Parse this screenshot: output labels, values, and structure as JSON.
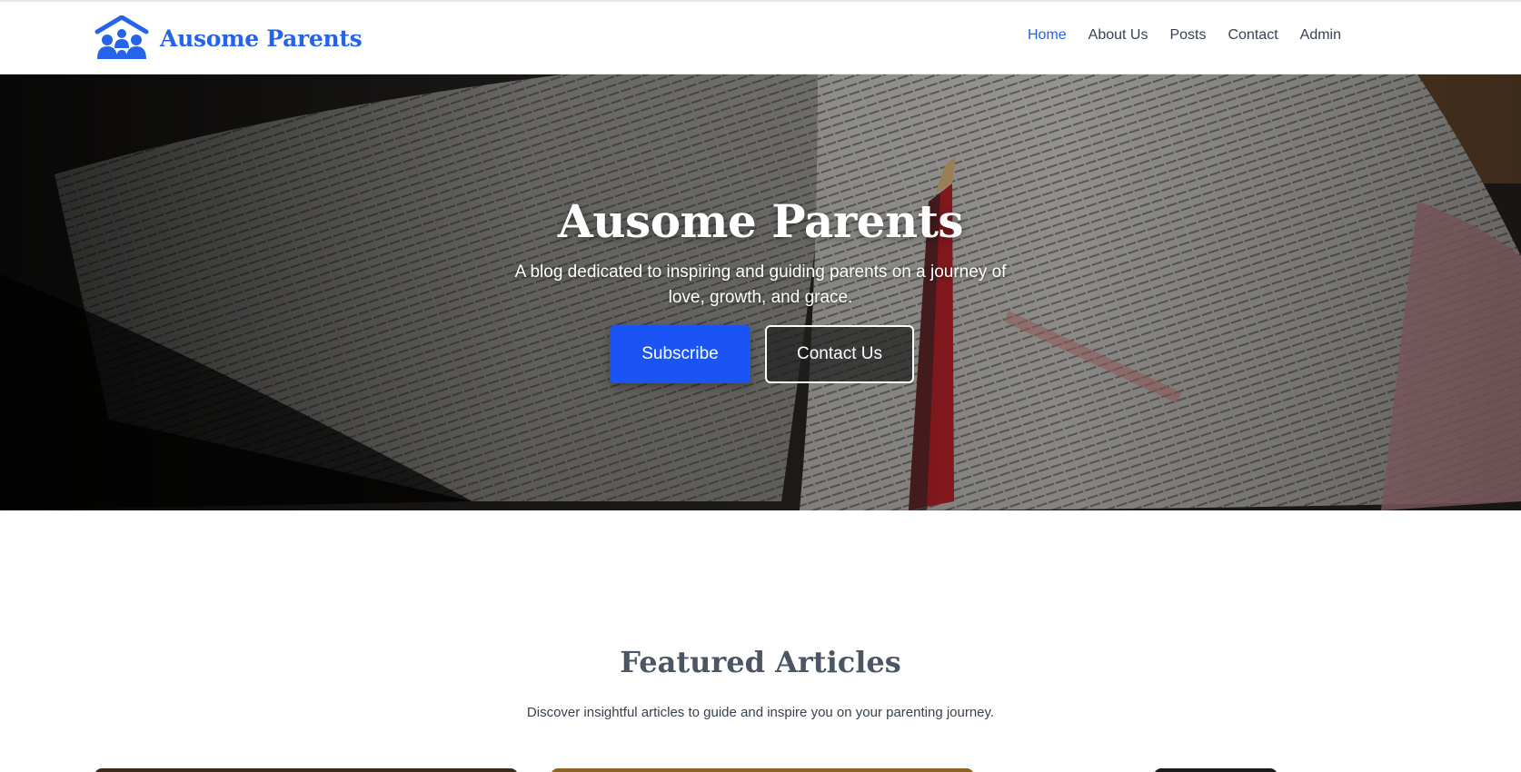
{
  "brand": {
    "name": "Ausome Parents",
    "logo_icon": "family-house-icon",
    "color": "#2563eb"
  },
  "nav": {
    "items": [
      {
        "label": "Home",
        "active": true
      },
      {
        "label": "About Us",
        "active": false
      },
      {
        "label": "Posts",
        "active": false
      },
      {
        "label": "Contact",
        "active": false
      },
      {
        "label": "Admin",
        "active": false
      }
    ]
  },
  "hero": {
    "title": "Ausome Parents",
    "subtitle": "A blog dedicated to inspiring and guiding parents on a journey of love, growth, and grace.",
    "subscribe_label": "Subscribe",
    "contact_label": "Contact Us",
    "background": "open-bible-with-red-pencil"
  },
  "featured": {
    "title": "Featured Articles",
    "subtitle": "Discover insightful articles to guide and inspire you on your parenting journey."
  },
  "colors": {
    "accent": "#2563eb",
    "button_primary": "#1b54f5"
  }
}
